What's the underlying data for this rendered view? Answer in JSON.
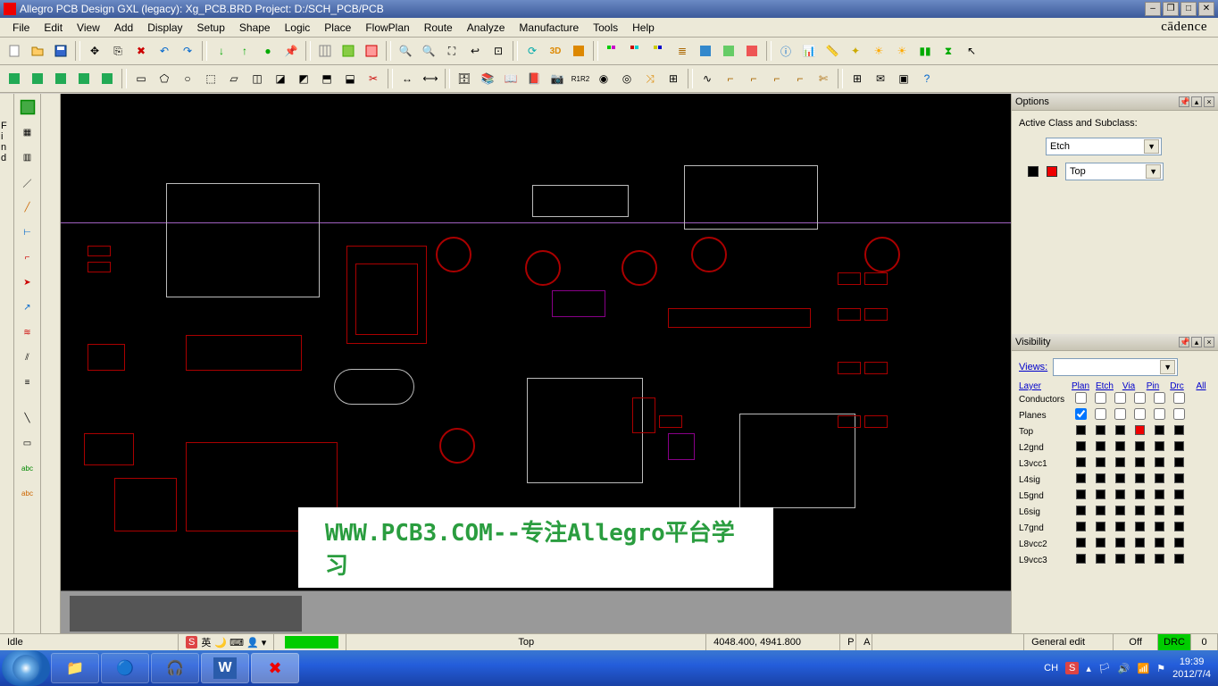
{
  "title": "Allegro PCB Design GXL (legacy): Xg_PCB.BRD   Project: D:/SCH_PCB/PCB",
  "brand": "cādence",
  "menu": [
    "File",
    "Edit",
    "View",
    "Add",
    "Display",
    "Setup",
    "Shape",
    "Logic",
    "Place",
    "FlowPlan",
    "Route",
    "Analyze",
    "Manufacture",
    "Tools",
    "Help"
  ],
  "find_tab": "Find",
  "options_panel": {
    "title": "Options",
    "label_class": "Active Class and Subclass:",
    "class_value": "Etch",
    "subclass_value": "Top"
  },
  "visibility_panel": {
    "title": "Visibility",
    "views_label": "Views:",
    "views_value": "",
    "layer_label": "Layer",
    "headers": [
      "Plan",
      "Etch",
      "Via",
      "Pin",
      "Drc",
      "All"
    ],
    "rows_top": [
      {
        "label": "Conductors"
      },
      {
        "label": "Planes"
      }
    ],
    "layers": [
      "Top",
      "L2gnd",
      "L3vcc1",
      "L4sig",
      "L5gnd",
      "L6sig",
      "L7gnd",
      "L8vcc2",
      "L9vcc3"
    ]
  },
  "watermark": "WWW.PCB3.COM--专注Allegro平台学习",
  "status": {
    "mode": "Idle",
    "ime": "英",
    "layer": "Top",
    "coords": "4048.400, 4941.800",
    "p": "P",
    "a": "A",
    "edit_mode": "General edit",
    "off": "Off",
    "drc": "DRC",
    "drc_count": "0"
  },
  "taskbar": {
    "lang": "CH",
    "time": "19:39",
    "date": "2012/7/4"
  }
}
